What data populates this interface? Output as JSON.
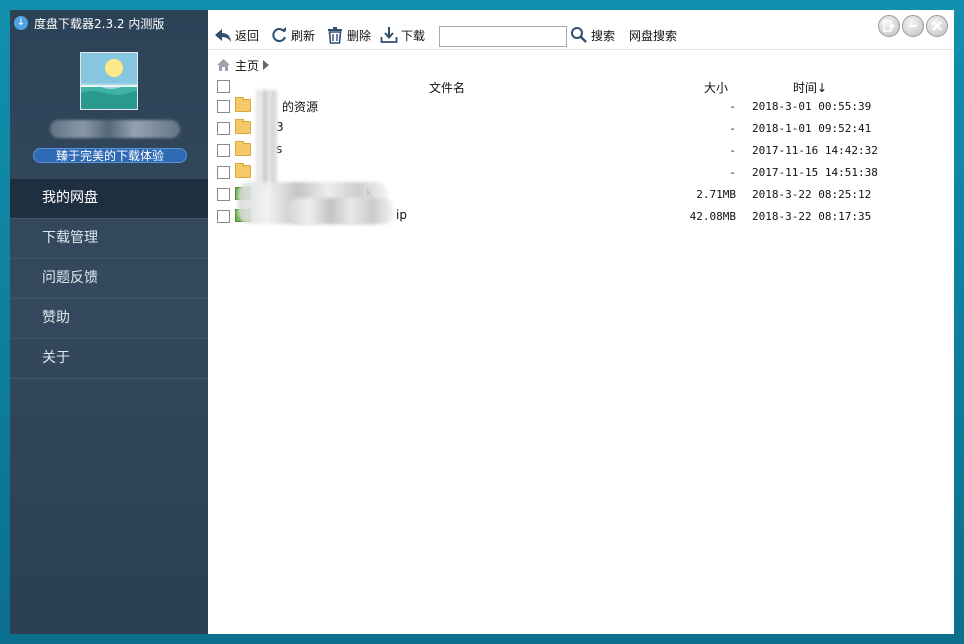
{
  "app": {
    "title": "度盘下载器2.3.2 内测版",
    "slogan": "臻于完美的下载体验"
  },
  "sidebar": {
    "items": [
      {
        "label": "我的网盘",
        "active": true
      },
      {
        "label": "下载管理",
        "active": false
      },
      {
        "label": "问题反馈",
        "active": false
      },
      {
        "label": "赞助",
        "active": false
      },
      {
        "label": "关于",
        "active": false
      }
    ]
  },
  "toolbar": {
    "back_label": "返回",
    "refresh_label": "刷新",
    "delete_label": "删除",
    "download_label": "下载",
    "search_value": "",
    "search_label": "搜索",
    "netdisk_search_label": "网盘搜索"
  },
  "breadcrumb": {
    "home_label": "主页"
  },
  "table": {
    "headers": {
      "name": "文件名",
      "size": "大小",
      "time": "时间↓"
    },
    "rows": [
      {
        "type": "folder",
        "name": "的资源",
        "size": "-",
        "time": "2018-3-01 00:55:39"
      },
      {
        "type": "folder",
        "name": "3",
        "size": "-",
        "time": "2018-1-01 09:52:41"
      },
      {
        "type": "folder",
        "name": "s",
        "size": "-",
        "time": "2017-11-16 14:42:32"
      },
      {
        "type": "folder",
        "name": "",
        "size": "-",
        "time": "2017-11-15 14:51:38"
      },
      {
        "type": "file",
        "name": "k",
        "size": "2.71MB",
        "time": "2018-3-22 08:25:12"
      },
      {
        "type": "file",
        "name": "ip",
        "size": "42.08MB",
        "time": "2018-3-22 08:17:35"
      }
    ]
  },
  "colors": {
    "window_frame": "#0e7896",
    "sidebar_bg": "#34495e",
    "nav_active_bg": "#1e2f40",
    "slogan_bg": "#2f6bb5",
    "folder": "#f3c96a",
    "file_green": "#6fb34a"
  }
}
